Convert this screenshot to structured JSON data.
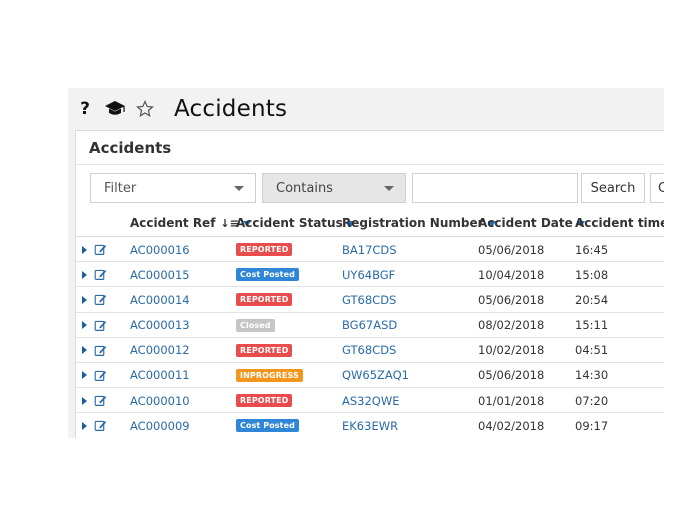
{
  "page": {
    "title": "Accidents"
  },
  "panel": {
    "title": "Accidents"
  },
  "filters": {
    "filter_label": "Filter",
    "operator_label": "Contains",
    "search_value": "",
    "search_button": "Search",
    "clear_button": "C"
  },
  "columns": [
    {
      "label": "Accident Ref",
      "sort": "descending",
      "filter": true
    },
    {
      "label": "Accident Status",
      "filter": true
    },
    {
      "label": "Registration Number",
      "filter": true
    },
    {
      "label": "Accident Date",
      "filter": true
    },
    {
      "label": "Accident time",
      "filter": true
    }
  ],
  "status_colors": {
    "REPORTED": "#e84c4c",
    "Cost Posted": "#2f86d6",
    "Closed": "#c6c6c6",
    "INPROGRESS": "#f3961d"
  },
  "rows": [
    {
      "ref": "AC000016",
      "status": "REPORTED",
      "registration": "BA17CDS",
      "date": "05/06/2018",
      "time": "16:45"
    },
    {
      "ref": "AC000015",
      "status": "Cost Posted",
      "registration": "UY64BGF",
      "date": "10/04/2018",
      "time": "15:08"
    },
    {
      "ref": "AC000014",
      "status": "REPORTED",
      "registration": "GT68CDS",
      "date": "05/06/2018",
      "time": "20:54"
    },
    {
      "ref": "AC000013",
      "status": "Closed",
      "registration": "BG67ASD",
      "date": "08/02/2018",
      "time": "15:11"
    },
    {
      "ref": "AC000012",
      "status": "REPORTED",
      "registration": "GT68CDS",
      "date": "10/02/2018",
      "time": "04:51"
    },
    {
      "ref": "AC000011",
      "status": "INPROGRESS",
      "registration": "QW65ZAQ1",
      "date": "05/06/2018",
      "time": "14:30"
    },
    {
      "ref": "AC000010",
      "status": "REPORTED",
      "registration": "AS32QWE",
      "date": "01/01/2018",
      "time": "07:20"
    },
    {
      "ref": "AC000009",
      "status": "Cost Posted",
      "registration": "EK63EWR",
      "date": "04/02/2018",
      "time": "09:17"
    }
  ]
}
